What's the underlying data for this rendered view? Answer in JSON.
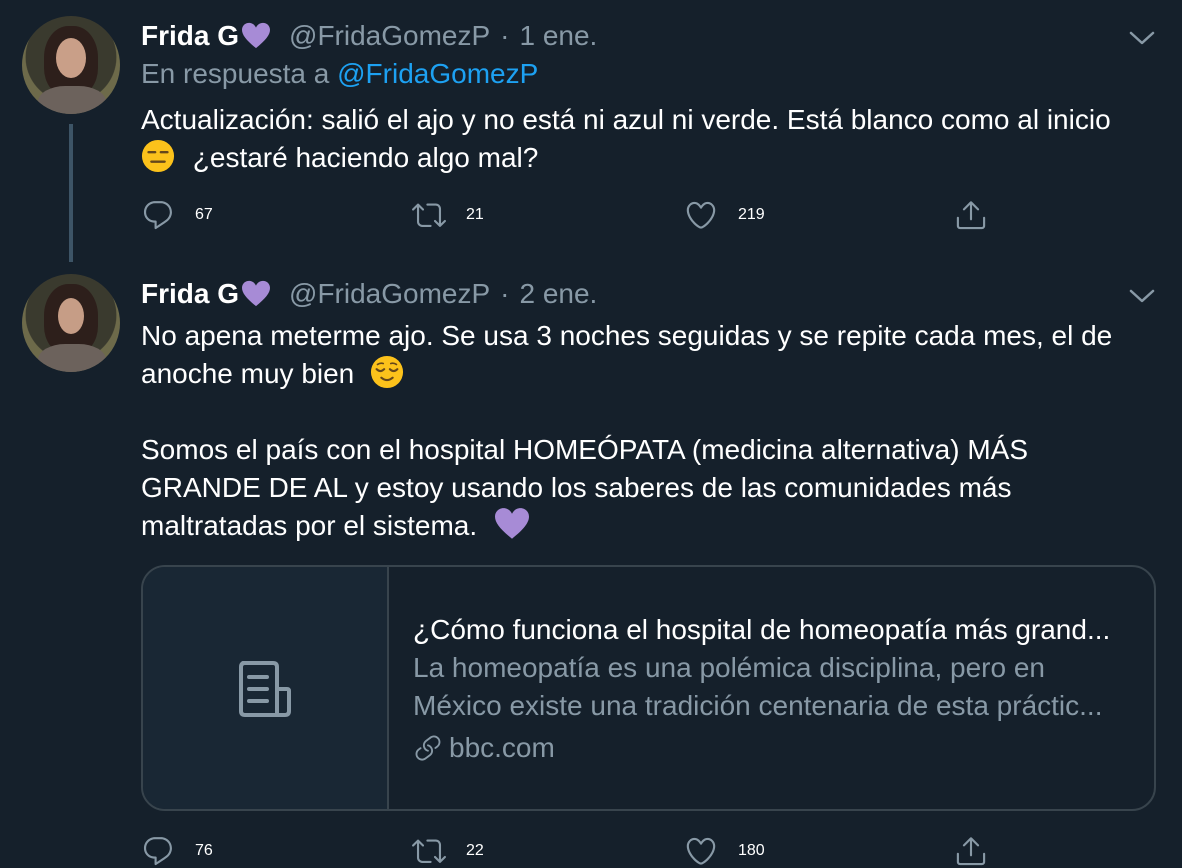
{
  "tweets": [
    {
      "name": "Frida G",
      "handle": "@FridaGomezP",
      "separator": "·",
      "date": "1 ene.",
      "reply_prefix": "En respuesta a",
      "reply_mention": "@FridaGomezP",
      "text_line1": "Actualización: salió el ajo y no está ni azul ni verde. Está blanco como al inicio",
      "text_line2": "¿estaré haciendo algo mal?",
      "replies": "67",
      "retweets": "21",
      "likes": "219"
    },
    {
      "name": "Frida G",
      "handle": "@FridaGomezP",
      "separator": "·",
      "date": "2 ene.",
      "para1_line1": "No apena meterme ajo. Se usa 3 noches seguidas y se repite cada mes, el de",
      "para1_line2": "anoche muy bien",
      "para2_line1": "Somos el país con el hospital HOMEÓPATA (medicina alternativa) MÁS",
      "para2_line2": "GRANDE DE AL y estoy usando los saberes de las comunidades más",
      "para2_line3": "maltratadas por el sistema.",
      "card": {
        "title": "¿Cómo funciona el hospital de homeopatía más grand...",
        "desc_line1": "La homeopatía es una polémica disciplina, pero en",
        "desc_line2": "México existe una tradición centenaria de esta práctic...",
        "domain": "bbc.com"
      },
      "replies": "76",
      "retweets": "22",
      "likes": "180"
    }
  ],
  "colors": {
    "background": "#15202b",
    "secondary_text": "#8899a6",
    "link": "#1da1f2",
    "border": "#38444d",
    "heart_emoji": "#a78bd6"
  },
  "icons": [
    "purple-heart-icon",
    "chevron-down-icon",
    "reply-icon",
    "retweet-icon",
    "like-icon",
    "share-icon",
    "expressionless-face-emoji",
    "relieved-face-emoji",
    "article-icon",
    "link-icon"
  ]
}
